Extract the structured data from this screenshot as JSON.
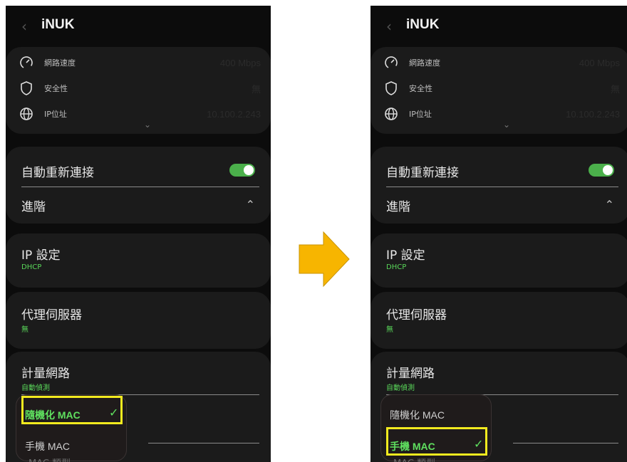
{
  "app": {
    "network_name": "iNUK"
  },
  "info": {
    "speed_label": "網路速度",
    "speed_value": "400 Mbps",
    "security_label": "安全性",
    "security_value": "無",
    "ip_label": "IP位址",
    "ip_value": "10.100.2.243"
  },
  "settings": {
    "auto_reconnect_label": "自動重新連接",
    "auto_reconnect_on": true,
    "advanced_label": "進階",
    "ip_settings_label": "IP 設定",
    "ip_settings_value": "DHCP",
    "proxy_label": "代理伺服器",
    "proxy_value": "無",
    "metered_label": "計量網路",
    "metered_value": "自動偵測"
  },
  "mac_menu": {
    "options": [
      "隨機化 MAC",
      "手機 MAC"
    ],
    "left_selected": "隨機化 MAC",
    "right_selected": "手機 MAC"
  },
  "cut_off_text": "MAC 類型",
  "colors": {
    "accent_green": "#5fe05f",
    "highlight": "#f2ea1f",
    "arrow": "#f7b500"
  }
}
